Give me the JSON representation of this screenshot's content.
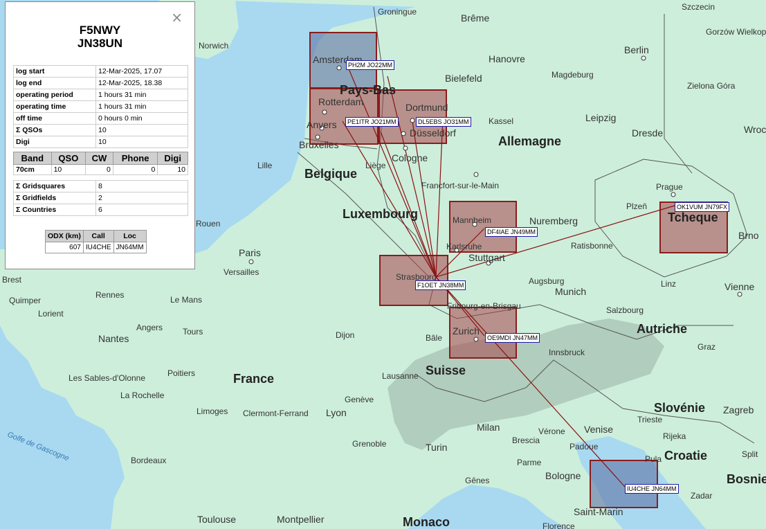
{
  "station": {
    "call": "F5NWY",
    "locator": "JN38UN",
    "close_label": "×"
  },
  "log": [
    {
      "key": "log start",
      "value": "12-Mar-2025, 17.07"
    },
    {
      "key": "log end",
      "value": "12-Mar-2025, 18.38"
    },
    {
      "key": "operating period",
      "value": "1 hours 31 min"
    },
    {
      "key": "operating time",
      "value": "1 hours 31 min"
    },
    {
      "key": "off time",
      "value": "0 hours 0 min"
    },
    {
      "key": "Σ QSOs",
      "value": "10"
    },
    {
      "key": "Digi",
      "value": "10"
    }
  ],
  "band_table": {
    "headers": [
      "Band",
      "QSO",
      "CW",
      "Phone",
      "Digi"
    ],
    "rows": [
      [
        "70cm",
        "10",
        "0",
        "0",
        "10"
      ]
    ]
  },
  "grid_stats": [
    {
      "key": "Σ Gridsquares",
      "value": "8"
    },
    {
      "key": "Σ Gridfields",
      "value": "2"
    },
    {
      "key": "Σ Countries",
      "value": "6"
    }
  ],
  "odx": {
    "headers": [
      "ODX (km)",
      "Call",
      "Loc"
    ],
    "row": [
      "607",
      "IU4CHE",
      "JN64MM"
    ]
  },
  "contacts": [
    {
      "label": "PH2M JO22MM"
    },
    {
      "label": "PE1ITR JO21MM"
    },
    {
      "label": "DL5EBS JO31MM"
    },
    {
      "label": "DF4IAE JN49MM"
    },
    {
      "label": "OK1VUM JN79FX"
    },
    {
      "label": "F1OET JN38MM"
    },
    {
      "label": "OE9MDI JN47MM"
    },
    {
      "label": "IU4CHE JN64MM"
    }
  ],
  "map_labels": {
    "countries": [
      "Pays-Bas",
      "Belgique",
      "Luxembourg",
      "Allemagne",
      "France",
      "Suisse",
      "Tcheque",
      "Autriche",
      "Slovénie",
      "Croatie",
      "Bosnie",
      "Monaco"
    ],
    "cities": [
      "Szczecin",
      "Groningue",
      "Brême",
      "Gorzów Wielkopolski",
      "Norwich",
      "Berlin",
      "Amsterdam",
      "Hanovre",
      "Bielefeld",
      "Magdeburg",
      "Rotterdam",
      "Dortmund",
      "Zielona Góra",
      "Kassel",
      "Leipzig",
      "Dresde",
      "Anvers",
      "Düsseldorf",
      "Wroc",
      "Bruxelles",
      "Cologne",
      "Lille",
      "Liège",
      "Prague",
      "Francfort-sur-le-Main",
      "Plzeň",
      "Rouen",
      "Mannheim",
      "Nuremberg",
      "Brno",
      "Paris",
      "Karlsruhe",
      "Stuttgart",
      "Ratisbonne",
      "Versailles",
      "Brest",
      "Strasbourg",
      "Augsburg",
      "Linz",
      "Vienne",
      "Quimper",
      "Rennes",
      "Le Mans",
      "Munich",
      "Lorient",
      "Fribourg-en-Brisgau",
      "Salzbourg",
      "Angers",
      "Tours",
      "Zurich",
      "Nantes",
      "Dijon",
      "Bâle",
      "Innsbruck",
      "Graz",
      "Les Sables-d'Olonne",
      "Poitiers",
      "Lausanne",
      "La Rochelle",
      "Genève",
      "Limoges",
      "Clermont-Ferrand",
      "Lyon",
      "Trieste",
      "Zagreb",
      "Milan",
      "Vérone",
      "Venise",
      "Rijeka",
      "Brescia",
      "Grenoble",
      "Turin",
      "Padoue",
      "Bordeaux",
      "Parme",
      "Pula",
      "Split",
      "Bologne",
      "Gênes",
      "Zadar",
      "Toulouse",
      "Montpellier",
      "Saint-Marin",
      "Florence"
    ],
    "sea": "Golfe de Gascogne"
  },
  "colors": {
    "square": "#a8464a",
    "path": "#8b1010",
    "tag_border": "#1a1aa8",
    "land": "#c9ecd8",
    "sea": "#a8d9f0"
  }
}
